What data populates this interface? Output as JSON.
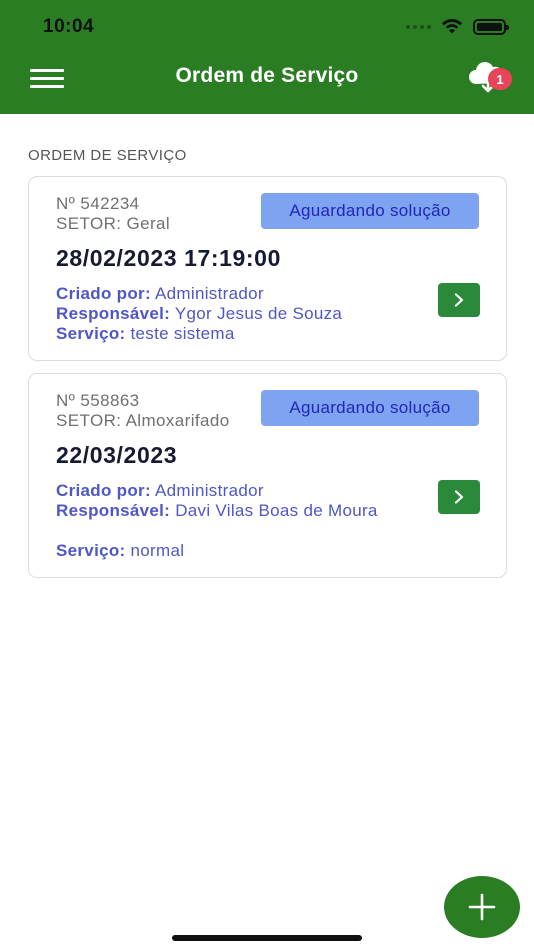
{
  "status_bar": {
    "time": "10:04"
  },
  "header": {
    "title": "Ordem de Serviço",
    "sync_badge_count": "1"
  },
  "section": {
    "title": "ORDEM DE SERVIÇO"
  },
  "orders": [
    {
      "number": "Nº 542234",
      "sector": "SETOR: Geral",
      "status": "Aguardando solução",
      "datetime": "28/02/2023 17:19:00",
      "created_by_label": "Criado por:",
      "created_by": "Administrador",
      "responsible_label": "Responsável:",
      "responsible": "Ygor Jesus de Souza",
      "service_label": "Serviço:",
      "service": "teste sistema"
    },
    {
      "number": "Nº 558863",
      "sector": "SETOR: Almoxarifado",
      "status": "Aguardando solução",
      "datetime": "22/03/2023",
      "created_by_label": "Criado por:",
      "created_by": "Administrador",
      "responsible_label": "Responsável:",
      "responsible": "Davi Vilas Boas de Moura",
      "service_label": "Serviço:",
      "service": "normal"
    }
  ],
  "colors": {
    "header_green": "#2a7d23",
    "status_badge_bg": "#7ea3f1",
    "status_badge_text": "#2326b8",
    "label_blue": "#4f57c7",
    "go_button_green": "#2a8a3a",
    "badge_red": "#e8455a"
  },
  "icons": {
    "menu": "hamburger-icon",
    "sync": "cloud-download-icon",
    "go": "chevron-right-icon",
    "add": "plus-icon"
  }
}
